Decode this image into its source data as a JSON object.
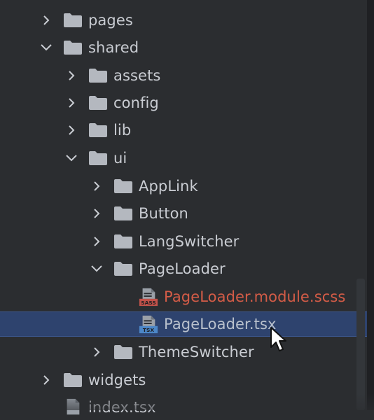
{
  "tree": {
    "items": [
      {
        "label": "pages",
        "type": "folder",
        "expanded": false
      },
      {
        "label": "shared",
        "type": "folder",
        "expanded": true
      },
      {
        "label": "assets",
        "type": "folder",
        "expanded": false
      },
      {
        "label": "config",
        "type": "folder",
        "expanded": false
      },
      {
        "label": "lib",
        "type": "folder",
        "expanded": false
      },
      {
        "label": "ui",
        "type": "folder",
        "expanded": true
      },
      {
        "label": "AppLink",
        "type": "folder",
        "expanded": false
      },
      {
        "label": "Button",
        "type": "folder",
        "expanded": false
      },
      {
        "label": "LangSwitcher",
        "type": "folder",
        "expanded": false
      },
      {
        "label": "PageLoader",
        "type": "folder",
        "expanded": true
      },
      {
        "label": "PageLoader.module.scss",
        "type": "file",
        "icon": "sass-file-icon",
        "badge": "SASS"
      },
      {
        "label": "PageLoader.tsx",
        "type": "file",
        "icon": "tsx-file-icon",
        "badge": "TSX",
        "selected": true
      },
      {
        "label": "ThemeSwitcher",
        "type": "folder",
        "expanded": false
      },
      {
        "label": "widgets",
        "type": "folder",
        "expanded": false
      },
      {
        "label": "index.tsx",
        "type": "file",
        "icon": "file-icon"
      }
    ]
  },
  "colors": {
    "background": "#2b2d30",
    "selection": "#2e436e",
    "text": "#c9ccd2",
    "scss_text": "#d45c47",
    "folder": "#b4b8bf"
  }
}
